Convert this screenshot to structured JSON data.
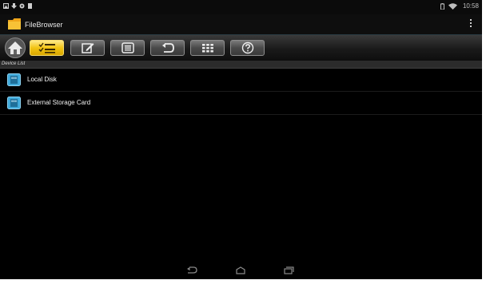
{
  "status_bar": {
    "time": "10:58",
    "left_icons": [
      "screenshot-icon",
      "download-icon",
      "settings-icon",
      "sd-card-icon"
    ],
    "right_icons": [
      "battery-icon",
      "wifi-icon"
    ]
  },
  "action_bar": {
    "title": "FileBrowser",
    "icon": "folder-icon",
    "overflow_icon": "overflow-menu-icon"
  },
  "toolbar": {
    "buttons": [
      {
        "icon": "home-icon",
        "active": false
      },
      {
        "icon": "checklist-icon",
        "active": true
      },
      {
        "icon": "edit-icon",
        "active": false
      },
      {
        "icon": "details-icon",
        "active": false
      },
      {
        "icon": "back-icon",
        "active": false
      },
      {
        "icon": "grid-icon",
        "active": false
      },
      {
        "icon": "help-icon",
        "active": false
      }
    ],
    "active_color": "#f2c414"
  },
  "device_list": {
    "header": "Device List",
    "items": [
      {
        "label": "Local Disk",
        "icon": "storage-icon"
      },
      {
        "label": "External Storage Card",
        "icon": "storage-icon"
      }
    ]
  },
  "nav_bar": {
    "buttons": [
      "back-nav-icon",
      "home-nav-icon",
      "recents-nav-icon"
    ]
  }
}
